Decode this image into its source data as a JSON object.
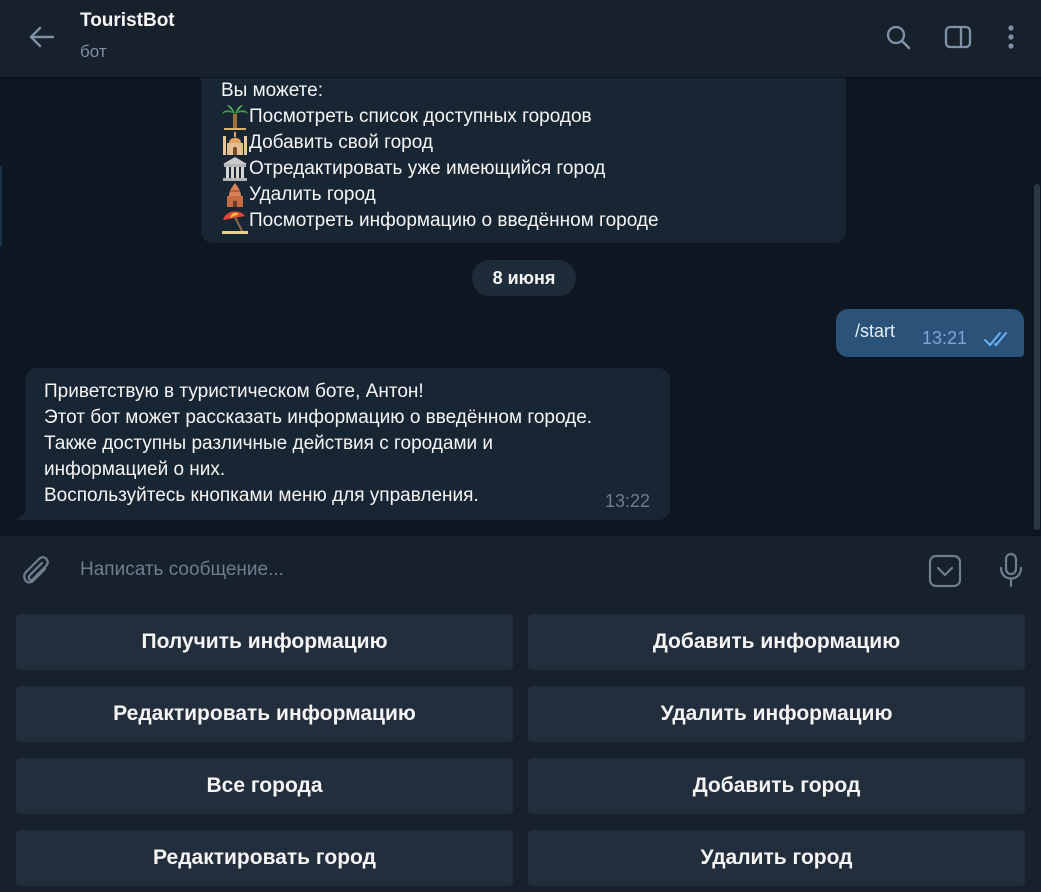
{
  "header": {
    "title": "TouristBot",
    "subtitle": "бот"
  },
  "colors": {
    "background": "#0e1621",
    "panel": "#17212b",
    "incoming_bubble": "#182533",
    "outgoing_bubble": "#2b5278",
    "keyboard_button": "#232e3c",
    "muted_text": "#6d7f8f",
    "read_check": "#6ab3f3"
  },
  "messages": {
    "menu": {
      "intro": "Вы можете:",
      "items": [
        {
          "icon": "palm-tree-emoji",
          "text": "Посмотреть список доступных городов"
        },
        {
          "icon": "mosque-emoji",
          "text": "Добавить свой город"
        },
        {
          "icon": "classical-building-emoji",
          "text": "Отредактировать уже имеющийся город"
        },
        {
          "icon": "hindu-temple-emoji",
          "text": "Удалить город"
        },
        {
          "icon": "beach-umbrella-emoji",
          "text": "Посмотреть информацию о введённом городе"
        }
      ]
    },
    "date_divider": "8 июня",
    "outgoing": {
      "text": "/start",
      "time": "13:21",
      "status": "read"
    },
    "incoming": {
      "lines": [
        "Приветствую в туристическом боте, Антон!",
        "Этот бот может рассказать информацию о введённом городе.",
        "Также доступны различные действия с городами и",
        "информацией о них.",
        "Воспользуйтесь кнопками меню для управления."
      ],
      "time": "13:22"
    }
  },
  "composer": {
    "placeholder": "Написать сообщение..."
  },
  "reply_keyboard": {
    "buttons": [
      "Получить информацию",
      "Добавить информацию",
      "Редактировать информацию",
      "Удалить информацию",
      "Все города",
      "Добавить город",
      "Редактировать город",
      "Удалить город"
    ]
  }
}
